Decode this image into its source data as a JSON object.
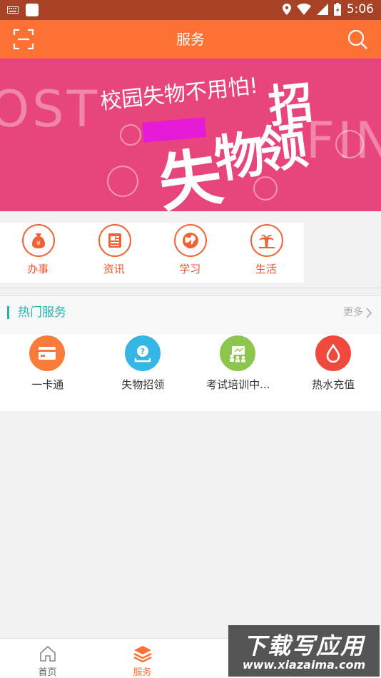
{
  "status_bar": {
    "time": "5:06"
  },
  "app_bar": {
    "title": "服务",
    "left_icon": "scan-icon",
    "right_icon": "search-icon"
  },
  "banner": {
    "headline": "校园失物不用怕!",
    "big_1": "失",
    "big_2": "物",
    "big_3": "招",
    "big_4": "领",
    "left_word": "OST",
    "right_word": "FIN"
  },
  "quick_menu": [
    {
      "label": "办事",
      "icon": "money-bag-icon"
    },
    {
      "label": "资讯",
      "icon": "news-icon"
    },
    {
      "label": "学习",
      "icon": "globe-icon"
    },
    {
      "label": "生活",
      "icon": "palm-tree-icon"
    }
  ],
  "hot_services": {
    "title": "热门服务",
    "more": "更多",
    "items": [
      {
        "label": "一卡通",
        "icon": "card-icon",
        "color": "#fa7c3b"
      },
      {
        "label": "失物招领",
        "icon": "lost-found-icon",
        "color": "#35b6e5"
      },
      {
        "label": "考试培训中...",
        "icon": "training-icon",
        "color": "#8cc64f"
      },
      {
        "label": "热水充值",
        "icon": "water-drop-icon",
        "color": "#ef4a3d"
      }
    ]
  },
  "bottom_nav": [
    {
      "label": "首页",
      "icon": "home-icon",
      "active": false
    },
    {
      "label": "服务",
      "icon": "layers-icon",
      "active": true
    }
  ],
  "watermark": {
    "line1": "下载写应用",
    "line2": "www.xiazaima.com"
  },
  "colors": {
    "primary": "#fe7134",
    "status": "#a84226",
    "banner": "#e8457c",
    "accent_teal": "#1fb5b0"
  }
}
